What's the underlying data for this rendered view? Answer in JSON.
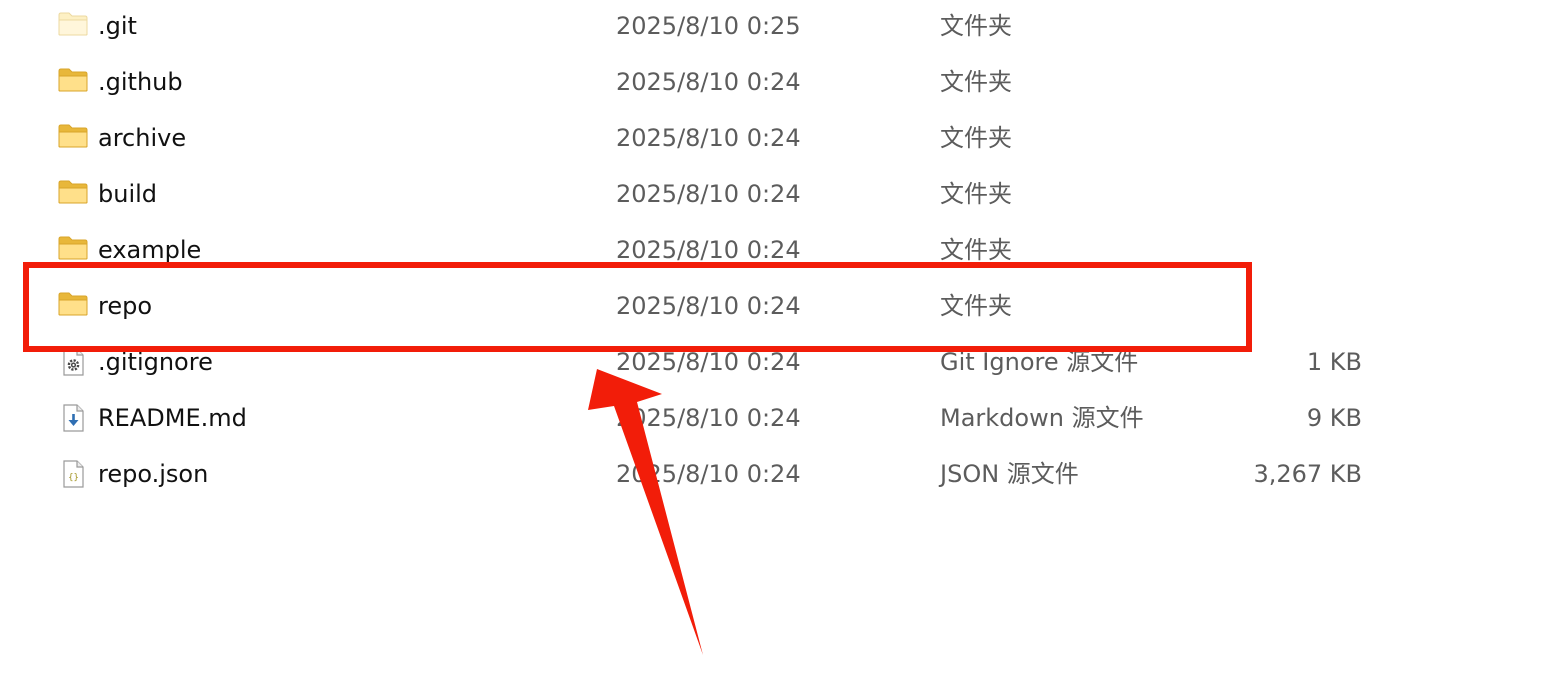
{
  "file_list": {
    "rows": [
      {
        "name": ".git",
        "date": "2025/8/10 0:25",
        "type": "文件夹",
        "size": "",
        "icon": "folder-icon",
        "faded": true
      },
      {
        "name": ".github",
        "date": "2025/8/10 0:24",
        "type": "文件夹",
        "size": "",
        "icon": "folder-icon"
      },
      {
        "name": "archive",
        "date": "2025/8/10 0:24",
        "type": "文件夹",
        "size": "",
        "icon": "folder-icon"
      },
      {
        "name": "build",
        "date": "2025/8/10 0:24",
        "type": "文件夹",
        "size": "",
        "icon": "folder-icon"
      },
      {
        "name": "example",
        "date": "2025/8/10 0:24",
        "type": "文件夹",
        "size": "",
        "icon": "folder-icon"
      },
      {
        "name": "repo",
        "date": "2025/8/10 0:24",
        "type": "文件夹",
        "size": "",
        "icon": "folder-icon"
      },
      {
        "name": ".gitignore",
        "date": "2025/8/10 0:24",
        "type": "Git Ignore 源文件",
        "size": "1 KB",
        "icon": "gear-file-icon"
      },
      {
        "name": "README.md",
        "date": "2025/8/10 0:24",
        "type": "Markdown 源文件",
        "size": "9 KB",
        "icon": "download-file-icon"
      },
      {
        "name": "repo.json",
        "date": "2025/8/10 0:24",
        "type": "JSON 源文件",
        "size": "3,267 KB",
        "icon": "json-file-icon"
      }
    ]
  },
  "annotation": {
    "highlighted_row": "repo",
    "color": "#f21d09"
  },
  "colors": {
    "folder": "#f5c542",
    "folder_light": "#ffe08a",
    "text_primary": "#111111",
    "text_secondary": "#5c5c5c"
  }
}
